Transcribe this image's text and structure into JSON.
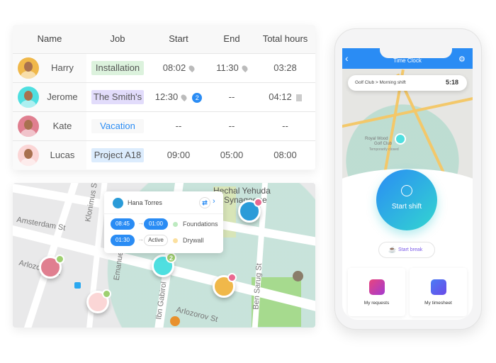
{
  "table": {
    "headers": [
      "Name",
      "Job",
      "Start",
      "End",
      "Total hours"
    ],
    "rows": [
      {
        "name": "Harry",
        "job": "Installation",
        "job_bg": "#dcf2dd",
        "job_color": "#555",
        "start": "08:02",
        "end": "11:30",
        "total": "03:28",
        "avatar": "#f0b84a",
        "start_icon": "location-pin",
        "end_icon": "location-pin"
      },
      {
        "name": "Jerome",
        "job": "The Smith's",
        "job_bg": "#e2dcfb",
        "job_color": "#555",
        "start": "12:30",
        "start_badge": "2",
        "end": "--",
        "total": "04:12",
        "avatar": "#4fdfe0",
        "start_icon": "location-pin",
        "total_icon": "document"
      },
      {
        "name": "Kate",
        "job": "Vacation",
        "job_bg": "#f8f8f8",
        "job_color": "#2a8cf4",
        "start": "--",
        "end": "--",
        "total": "--",
        "avatar": "#e07f90"
      },
      {
        "name": "Lucas",
        "job": "Project A18",
        "job_bg": "#dcecfd",
        "job_color": "#555",
        "start": "09:00",
        "end": "05:00",
        "total": "08:00",
        "avatar": "#fbd6d6"
      }
    ]
  },
  "map": {
    "streets": [
      "Amsterdam St",
      "Klonimus St",
      "Arlozorov St",
      "Arlozorov St",
      "Emanuel",
      "Ibn Gabirol",
      "Ben Sarug St",
      "Hechal Yehuda",
      "Synagogue"
    ],
    "cluster_count": "2",
    "popup": {
      "name": "Hana Torres",
      "entries": [
        {
          "from": "08:45",
          "to": "01:00",
          "job": "Foundations",
          "color": "#bdeac0"
        },
        {
          "from": "01:30",
          "to": "Active",
          "job": "Drywall",
          "color": "#fbe0a0"
        }
      ]
    }
  },
  "phone": {
    "title": "Time Clock",
    "location": "Golf Club > Morning shift",
    "timer": "5:18",
    "map_labels": [
      "Royal Wood",
      "Golf Club",
      "Temporarily closed"
    ],
    "start_shift": "Start shift",
    "start_break": "Start break",
    "tiles": [
      {
        "label": "My requests",
        "color": "#d9368e"
      },
      {
        "label": "My timesheet",
        "color": "#5a5af0"
      }
    ],
    "accent": "#2a8cf4"
  }
}
